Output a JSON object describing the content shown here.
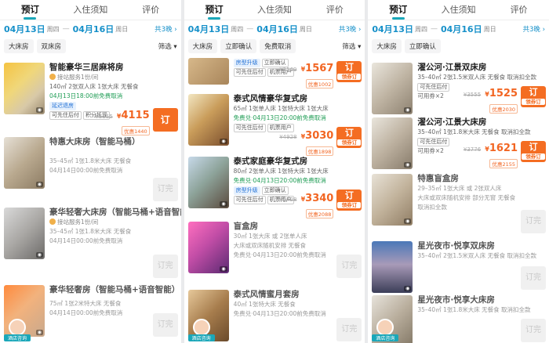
{
  "colors": {
    "accent": "#1aa7b9",
    "date": "#1690c9",
    "price": "#f26522",
    "book": "#f46d22"
  },
  "panels": [
    {
      "tabs": [
        "预订",
        "入住须知",
        "评价"
      ],
      "date": {
        "checkin": "04月13日",
        "checkin_wk": "周四",
        "checkout": "04月16日",
        "checkout_wk": "周日",
        "nights": "共3晚 ›"
      },
      "filters": [
        "大床房",
        "双床房"
      ],
      "filter_more": "筛选 ▾",
      "rooms": [
        {
          "name": "智能豪华三居麻将房",
          "svc": "接站服务1份/间",
          "l1": "140㎡ 2张双人床 1张大床 无餐食",
          "l2": "04月13日18:00前免费取消",
          "tags": [
            "延迟退房",
            "可先住后付",
            "积分抵现"
          ],
          "strike": "¥5555",
          "price": "4115",
          "disc": "优惠1440",
          "btn": "订"
        },
        {
          "name": "特惠大床房（智能马桶）",
          "svc": "",
          "l1": "35–45㎡ 1张1.8米大床 无餐食",
          "l2": "04月14日00:00前免费取消",
          "btn": "订完"
        },
        {
          "name": "豪华轻奢大床房（智能马桶+语音智能）",
          "svc": "接站服务1份/间",
          "l1": "35–45㎡ 1张1.8米大床 无餐食",
          "l2": "04月14日00:00前免费取消",
          "btn": "订完"
        },
        {
          "name": "豪华轻奢房（智能马桶+语音智能）",
          "svc": "",
          "l1": "75㎡ 1张2米特大床 无餐食",
          "l2": "04月14日00:00前免费取消",
          "btn": "订完"
        }
      ],
      "consult": "酒店咨询"
    },
    {
      "tabs": [
        "预订",
        "入住须知",
        "评价"
      ],
      "date": {
        "checkin": "04月13日",
        "checkin_wk": "周四",
        "checkout": "04月16日",
        "checkout_wk": "周日",
        "nights": "共3晚 ›"
      },
      "filters": [
        "大床房",
        "立即确认",
        "免费取消"
      ],
      "filter_more": "筛选 ▾",
      "rooms": [
        {
          "name": "",
          "l0a": "房型升级",
          "l0b": "立即确认",
          "l0c": "可先住后付",
          "l0d": "机票用户",
          "strike": "¥2569",
          "price": "1567",
          "disc": "优惠1002",
          "btn": "订",
          "btn_sub": "领券订"
        },
        {
          "name": "泰式风情豪华复式房",
          "l1": "65㎡ 1张单人床 1张特大床 1张大床",
          "l2": "免费兑·04月13日20:00前免费取消",
          "tags": [
            "可先住后付",
            "机票用户"
          ],
          "strike": "¥4928",
          "price": "3030",
          "disc": "优惠1898",
          "btn": "订",
          "btn_sub": "领券订"
        },
        {
          "name": "泰式家庭豪华复式房",
          "l1": "80㎡ 2张单人床 1张特大床 1张大床",
          "l2": "免费兑·04月13日20:00前免费取消",
          "tags": [
            "房型升级",
            "立即确认",
            "可先住后付",
            "机票用户"
          ],
          "strike": "¥5428",
          "price": "3340",
          "disc": "优惠2088",
          "btn": "订",
          "btn_sub": "领券订"
        },
        {
          "name": "盲盒房",
          "l1": "30㎡ 1张大床 或 2张单人床",
          "l2": "大床或双床随机安排 无餐食",
          "l3": "免费兑·04月13日20:00前免费取消",
          "btn": "订完"
        },
        {
          "name": "泰式风情蜜月套房",
          "l1": "40㎡ 1张特大床 无餐食",
          "l2": "免费兑·04月13日20:00前免费取消",
          "btn": "订完"
        }
      ],
      "consult": "酒店咨询"
    },
    {
      "tabs": [
        "预订",
        "入住须知",
        "评价"
      ],
      "date": {
        "checkin": "04月13日",
        "checkin_wk": "周四",
        "checkout": "04月16日",
        "checkout_wk": "周日",
        "nights": "共3晚 ›"
      },
      "filters": [
        "大床房",
        "立即确认"
      ],
      "filter_more": "",
      "rooms": [
        {
          "name": "濯公河·江景双床房",
          "l1": "35–40㎡ 2张1.5米双人床 无餐食 取消扣全款",
          "tags": [
            "可先住后付"
          ],
          "l3": "可用券×2",
          "strike": "¥3555",
          "price": "1525",
          "disc": "优惠2030",
          "btn": "订",
          "btn_sub": "领券订"
        },
        {
          "name": "濯公河·江景大床房",
          "l1": "35–40㎡ 1张1.8米大床 无餐食 取消扣全款",
          "tags": [
            "可先住后付"
          ],
          "l3": "可用券×2",
          "strike": "¥3776",
          "price": "1621",
          "disc": "优惠2155",
          "btn": "订",
          "btn_sub": "领券订"
        },
        {
          "name": "特惠盲盒房",
          "l1": "29–35㎡ 1张大床 或 2张双人床",
          "l2": "大床或双床随机安排 部分无窗 无餐食",
          "l3": "取消扣全款",
          "btn": "订完"
        },
        {
          "name": "星光夜市·悦享双床房",
          "l1": "35–40㎡ 2张1.5米双人床 无餐食 取消扣全款",
          "btn": "订完"
        },
        {
          "name": "星光夜市·悦享大床房",
          "l1": "35–40㎡ 1张1.8米大床 无餐食 取消扣全款",
          "btn": "订完"
        }
      ],
      "consult": "酒店咨询"
    }
  ]
}
